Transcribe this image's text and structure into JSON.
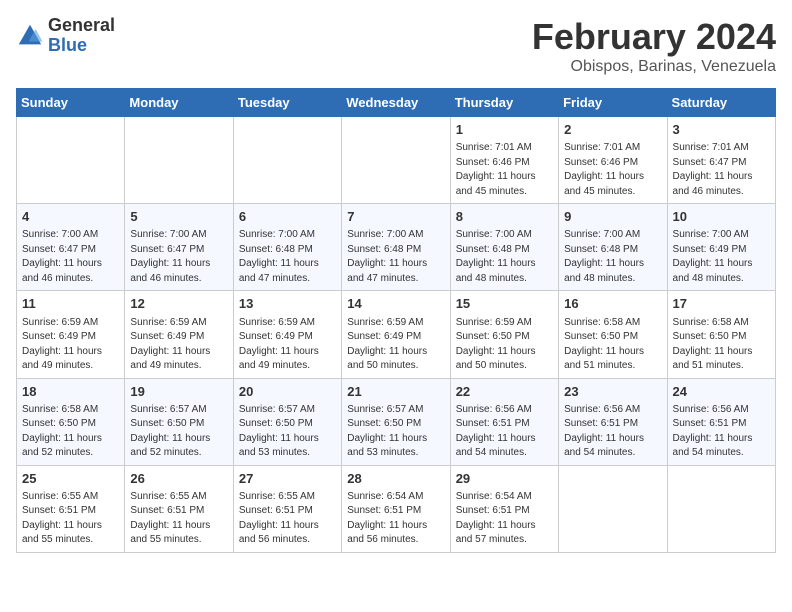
{
  "header": {
    "logo_general": "General",
    "logo_blue": "Blue",
    "month_year": "February 2024",
    "location": "Obispos, Barinas, Venezuela"
  },
  "weekdays": [
    "Sunday",
    "Monday",
    "Tuesday",
    "Wednesday",
    "Thursday",
    "Friday",
    "Saturday"
  ],
  "weeks": [
    [
      {
        "day": "",
        "info": ""
      },
      {
        "day": "",
        "info": ""
      },
      {
        "day": "",
        "info": ""
      },
      {
        "day": "",
        "info": ""
      },
      {
        "day": "1",
        "info": "Sunrise: 7:01 AM\nSunset: 6:46 PM\nDaylight: 11 hours and 45 minutes."
      },
      {
        "day": "2",
        "info": "Sunrise: 7:01 AM\nSunset: 6:46 PM\nDaylight: 11 hours and 45 minutes."
      },
      {
        "day": "3",
        "info": "Sunrise: 7:01 AM\nSunset: 6:47 PM\nDaylight: 11 hours and 46 minutes."
      }
    ],
    [
      {
        "day": "4",
        "info": "Sunrise: 7:00 AM\nSunset: 6:47 PM\nDaylight: 11 hours and 46 minutes."
      },
      {
        "day": "5",
        "info": "Sunrise: 7:00 AM\nSunset: 6:47 PM\nDaylight: 11 hours and 46 minutes."
      },
      {
        "day": "6",
        "info": "Sunrise: 7:00 AM\nSunset: 6:48 PM\nDaylight: 11 hours and 47 minutes."
      },
      {
        "day": "7",
        "info": "Sunrise: 7:00 AM\nSunset: 6:48 PM\nDaylight: 11 hours and 47 minutes."
      },
      {
        "day": "8",
        "info": "Sunrise: 7:00 AM\nSunset: 6:48 PM\nDaylight: 11 hours and 48 minutes."
      },
      {
        "day": "9",
        "info": "Sunrise: 7:00 AM\nSunset: 6:48 PM\nDaylight: 11 hours and 48 minutes."
      },
      {
        "day": "10",
        "info": "Sunrise: 7:00 AM\nSunset: 6:49 PM\nDaylight: 11 hours and 48 minutes."
      }
    ],
    [
      {
        "day": "11",
        "info": "Sunrise: 6:59 AM\nSunset: 6:49 PM\nDaylight: 11 hours and 49 minutes."
      },
      {
        "day": "12",
        "info": "Sunrise: 6:59 AM\nSunset: 6:49 PM\nDaylight: 11 hours and 49 minutes."
      },
      {
        "day": "13",
        "info": "Sunrise: 6:59 AM\nSunset: 6:49 PM\nDaylight: 11 hours and 49 minutes."
      },
      {
        "day": "14",
        "info": "Sunrise: 6:59 AM\nSunset: 6:49 PM\nDaylight: 11 hours and 50 minutes."
      },
      {
        "day": "15",
        "info": "Sunrise: 6:59 AM\nSunset: 6:50 PM\nDaylight: 11 hours and 50 minutes."
      },
      {
        "day": "16",
        "info": "Sunrise: 6:58 AM\nSunset: 6:50 PM\nDaylight: 11 hours and 51 minutes."
      },
      {
        "day": "17",
        "info": "Sunrise: 6:58 AM\nSunset: 6:50 PM\nDaylight: 11 hours and 51 minutes."
      }
    ],
    [
      {
        "day": "18",
        "info": "Sunrise: 6:58 AM\nSunset: 6:50 PM\nDaylight: 11 hours and 52 minutes."
      },
      {
        "day": "19",
        "info": "Sunrise: 6:57 AM\nSunset: 6:50 PM\nDaylight: 11 hours and 52 minutes."
      },
      {
        "day": "20",
        "info": "Sunrise: 6:57 AM\nSunset: 6:50 PM\nDaylight: 11 hours and 53 minutes."
      },
      {
        "day": "21",
        "info": "Sunrise: 6:57 AM\nSunset: 6:50 PM\nDaylight: 11 hours and 53 minutes."
      },
      {
        "day": "22",
        "info": "Sunrise: 6:56 AM\nSunset: 6:51 PM\nDaylight: 11 hours and 54 minutes."
      },
      {
        "day": "23",
        "info": "Sunrise: 6:56 AM\nSunset: 6:51 PM\nDaylight: 11 hours and 54 minutes."
      },
      {
        "day": "24",
        "info": "Sunrise: 6:56 AM\nSunset: 6:51 PM\nDaylight: 11 hours and 54 minutes."
      }
    ],
    [
      {
        "day": "25",
        "info": "Sunrise: 6:55 AM\nSunset: 6:51 PM\nDaylight: 11 hours and 55 minutes."
      },
      {
        "day": "26",
        "info": "Sunrise: 6:55 AM\nSunset: 6:51 PM\nDaylight: 11 hours and 55 minutes."
      },
      {
        "day": "27",
        "info": "Sunrise: 6:55 AM\nSunset: 6:51 PM\nDaylight: 11 hours and 56 minutes."
      },
      {
        "day": "28",
        "info": "Sunrise: 6:54 AM\nSunset: 6:51 PM\nDaylight: 11 hours and 56 minutes."
      },
      {
        "day": "29",
        "info": "Sunrise: 6:54 AM\nSunset: 6:51 PM\nDaylight: 11 hours and 57 minutes."
      },
      {
        "day": "",
        "info": ""
      },
      {
        "day": "",
        "info": ""
      }
    ]
  ]
}
